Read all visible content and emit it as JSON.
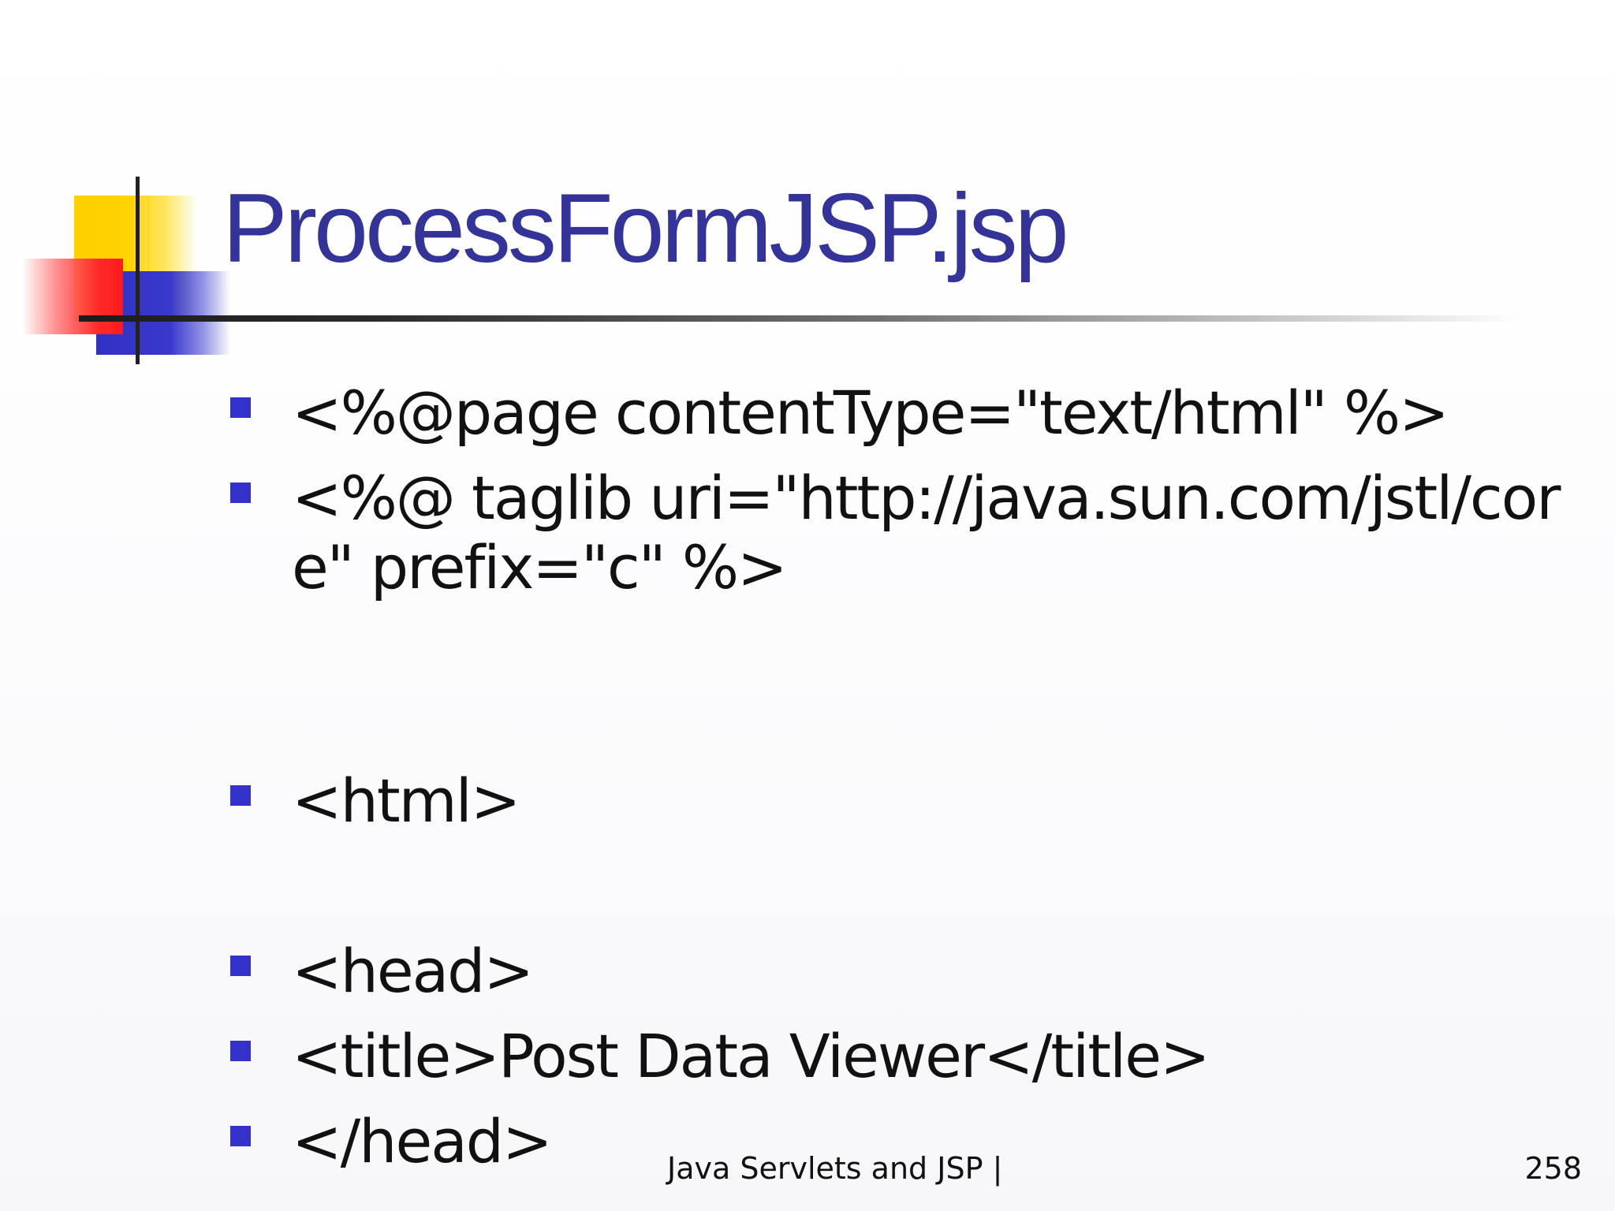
{
  "slide": {
    "title": "ProcessFormJSP.jsp",
    "bullets": [
      {
        "text": "<%@page contentType=\"text/html\" %>"
      },
      {
        "text": "<%@ taglib uri=\"http://java.sun.com/jstl/core\" prefix=\"c\" %>"
      },
      {
        "text": "<html>"
      },
      {
        "text": "<head>"
      },
      {
        "text": "<title>Post Data Viewer</title>"
      },
      {
        "text": "</head>"
      }
    ],
    "footer": {
      "text": "Java Servlets and JSP |",
      "page_number": "258"
    }
  },
  "colors": {
    "title": "#333399",
    "bullet_marker": "#3333cc",
    "text": "#111111",
    "deco_yellow": "#ffd000",
    "deco_red": "#ff2a2a",
    "deco_blue": "#3131c6"
  }
}
